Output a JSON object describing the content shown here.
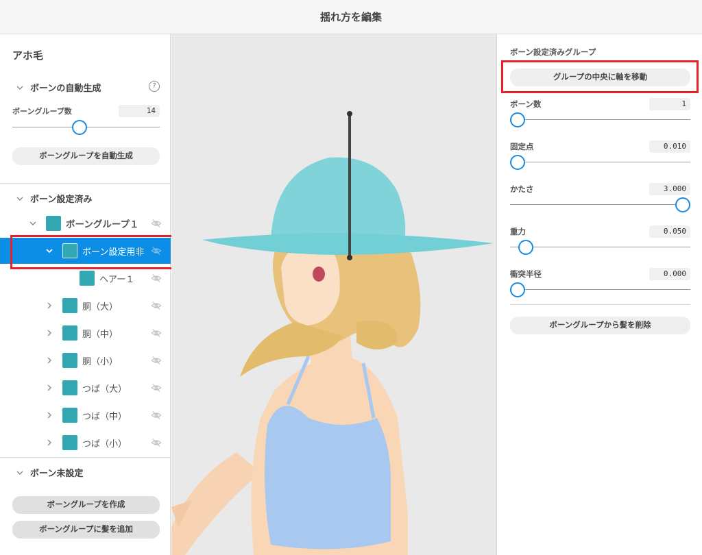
{
  "window": {
    "title": "揺れ方を編集"
  },
  "left_panel": {
    "hair_name": "アホ毛",
    "auto_gen": {
      "header": "ボーンの自動生成",
      "group_count_label": "ボーングループ数",
      "group_count_value": "14",
      "group_count_fraction": 0.45,
      "auto_gen_button": "ボーングループを自動生成"
    },
    "configured": {
      "header": "ボーン設定済み",
      "items": [
        {
          "label": "ボーングループ１",
          "level": 0,
          "expanded": true,
          "selected": false
        },
        {
          "label": "ボーン設定用非",
          "level": 1,
          "expanded": true,
          "selected": true
        },
        {
          "label": "ヘアー１",
          "level": 2,
          "expanded": false,
          "selected": false
        },
        {
          "label": "胴（大）",
          "level": 1,
          "expanded": false,
          "selected": false
        },
        {
          "label": "胴（中）",
          "level": 1,
          "expanded": false,
          "selected": false
        },
        {
          "label": "胴（小）",
          "level": 1,
          "expanded": false,
          "selected": false
        },
        {
          "label": "つば（大）",
          "level": 1,
          "expanded": false,
          "selected": false
        },
        {
          "label": "つば（中）",
          "level": 1,
          "expanded": false,
          "selected": false
        },
        {
          "label": "つば（小）",
          "level": 1,
          "expanded": false,
          "selected": false
        }
      ]
    },
    "unconfigured": {
      "header": "ボーン未設定",
      "create_button": "ボーングループを作成",
      "add_hair_button": "ボーングループに髪を追加"
    }
  },
  "right_panel": {
    "group_header": "ボーン設定済みグループ",
    "move_axis_button": "グループの中央に軸を移動",
    "params": [
      {
        "label": "ボーン数",
        "value": "1",
        "fraction": 0.0
      },
      {
        "label": "固定点",
        "value": "0.010",
        "fraction": 0.0
      },
      {
        "label": "かたさ",
        "value": "3.000",
        "fraction": 1.0
      },
      {
        "label": "重力",
        "value": "0.050",
        "fraction": 0.05
      },
      {
        "label": "衝突半径",
        "value": "0.000",
        "fraction": 0.0
      }
    ],
    "remove_hair_button": "ボーングループから髪を削除"
  },
  "colors": {
    "accent": "#0c8ee6",
    "swatch": "#32a8b2",
    "highlight": "#e8202a",
    "hat": "#7fd3d9"
  }
}
